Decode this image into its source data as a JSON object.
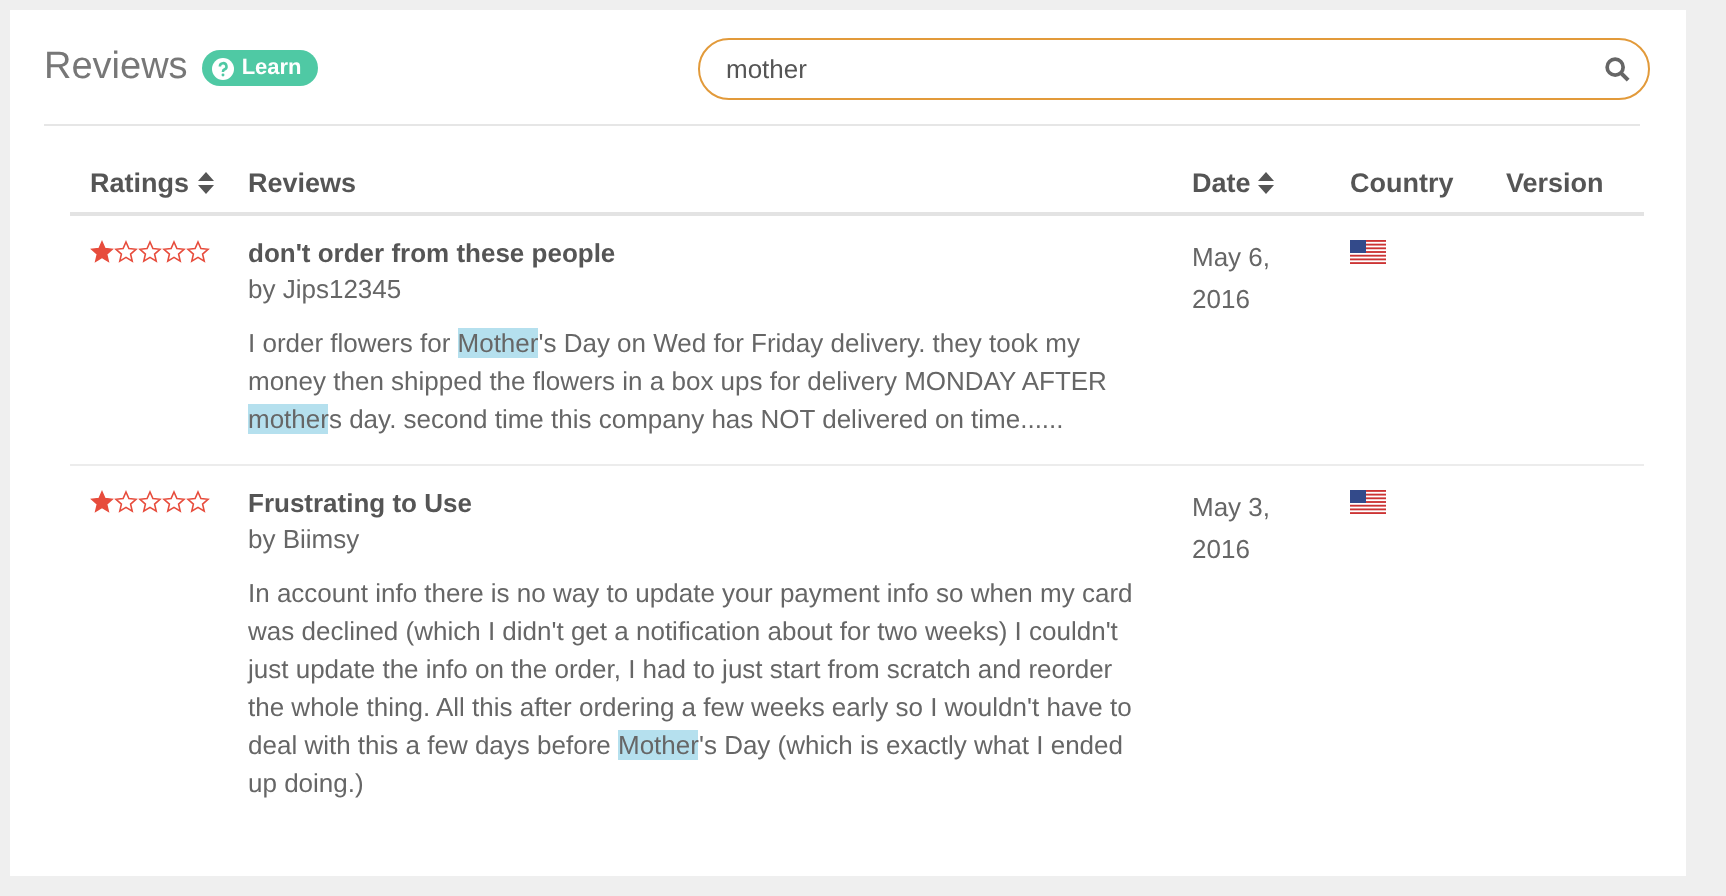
{
  "header": {
    "title": "Reviews",
    "learn_badge": "Learn"
  },
  "search": {
    "value": "mother"
  },
  "table": {
    "columns": [
      {
        "label": "Ratings",
        "sortable": true
      },
      {
        "label": "Reviews",
        "sortable": false
      },
      {
        "label": "Date",
        "sortable": true
      },
      {
        "label": "Country",
        "sortable": false
      },
      {
        "label": "Version",
        "sortable": false
      }
    ],
    "rows": [
      {
        "stars": 1,
        "title": "don't order from these people",
        "author": "by Jips12345",
        "date": "May 6, 2016",
        "body": [
          {
            "text": "I order flowers for ",
            "highlighted": false
          },
          {
            "text": "Mother",
            "highlighted": true
          },
          {
            "text": "'s Day on Wed for Friday delivery. they took my money then shipped the flowers in a box ups for delivery MONDAY AFTER ",
            "highlighted": false
          },
          {
            "text": "mother",
            "highlighted": true
          },
          {
            "text": "s day. second time this company has NOT delivered on time......",
            "highlighted": false
          }
        ]
      },
      {
        "stars": 1,
        "title": "Frustrating to Use",
        "author": "by Biimsy",
        "date": "May 3, 2016",
        "body": [
          {
            "text": "In account info there is no way to update your payment info so when my card was declined (which I didn't get a notification about for two weeks) I couldn't just update the info on the order, I had to just start from scratch and reorder the whole thing. All this after ordering a few weeks early so I wouldn't have to deal with this a few days before ",
            "highlighted": false
          },
          {
            "text": "Mother",
            "highlighted": true
          },
          {
            "text": "'s Day (which is exactly what I ended up doing.)",
            "highlighted": false
          }
        ]
      }
    ]
  }
}
